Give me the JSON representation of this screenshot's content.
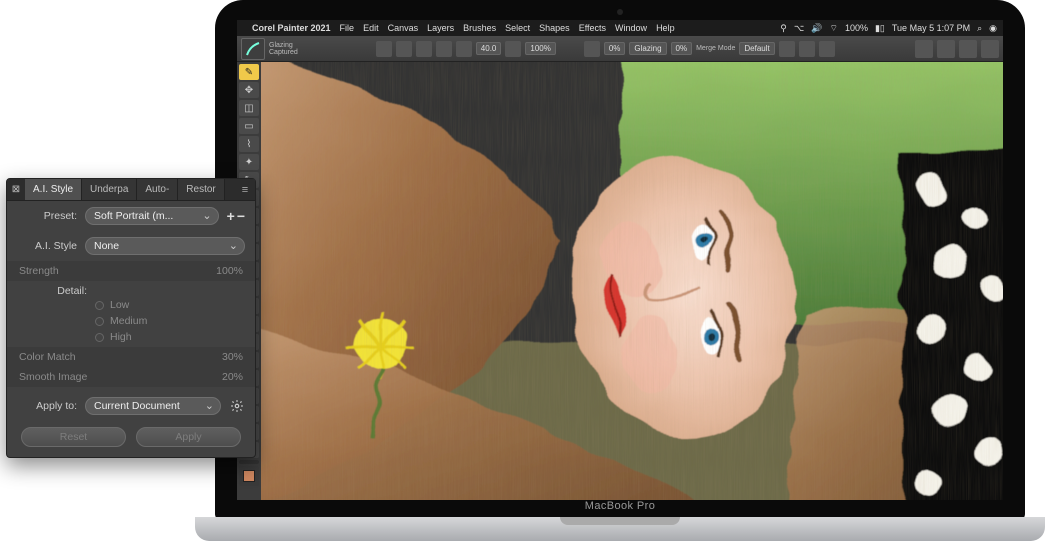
{
  "mac": {
    "app_name": "Corel Painter 2021",
    "menus": [
      "File",
      "Edit",
      "Canvas",
      "Layers",
      "Brushes",
      "Select",
      "Shapes",
      "Effects",
      "Window",
      "Help"
    ],
    "wifi_pct": "100%",
    "datetime": "Tue May 5  1:07 PM"
  },
  "toolbar": {
    "brush_category_label": "Glazing",
    "brush_name": "Captured",
    "size": "40.0",
    "opacity": "100%",
    "resat": "0%",
    "bleed_label": "Glazing",
    "bleed_val": "0%",
    "merge_label": "Merge Mode",
    "merge_val": "Default"
  },
  "tools": [
    "brush",
    "move",
    "crop",
    "select",
    "lasso",
    "wand",
    "eyedrop",
    "fill",
    "grad",
    "clone",
    "eraser",
    "pen",
    "text",
    "shape",
    "dodge",
    "hand",
    "zoom",
    "rotate",
    "color1",
    "color2",
    "divider",
    "swatch"
  ],
  "laptop_label": "MacBook Pro",
  "panel": {
    "tabs": [
      "A.I. Style",
      "Underpa",
      "Auto-",
      "Restor"
    ],
    "active_tab": 0,
    "preset_label": "Preset:",
    "preset_value": "Soft Portrait (m...",
    "style_label": "A.I. Style",
    "style_value": "None",
    "strength_label": "Strength",
    "strength_value": "100%",
    "detail_label": "Detail:",
    "detail_options": [
      "Low",
      "Medium",
      "High"
    ],
    "detail_selected": 1,
    "colormatch_label": "Color Match",
    "colormatch_value": "30%",
    "smooth_label": "Smooth Image",
    "smooth_value": "20%",
    "applyto_label": "Apply to:",
    "applyto_value": "Current Document",
    "reset_label": "Reset",
    "apply_label": "Apply"
  }
}
